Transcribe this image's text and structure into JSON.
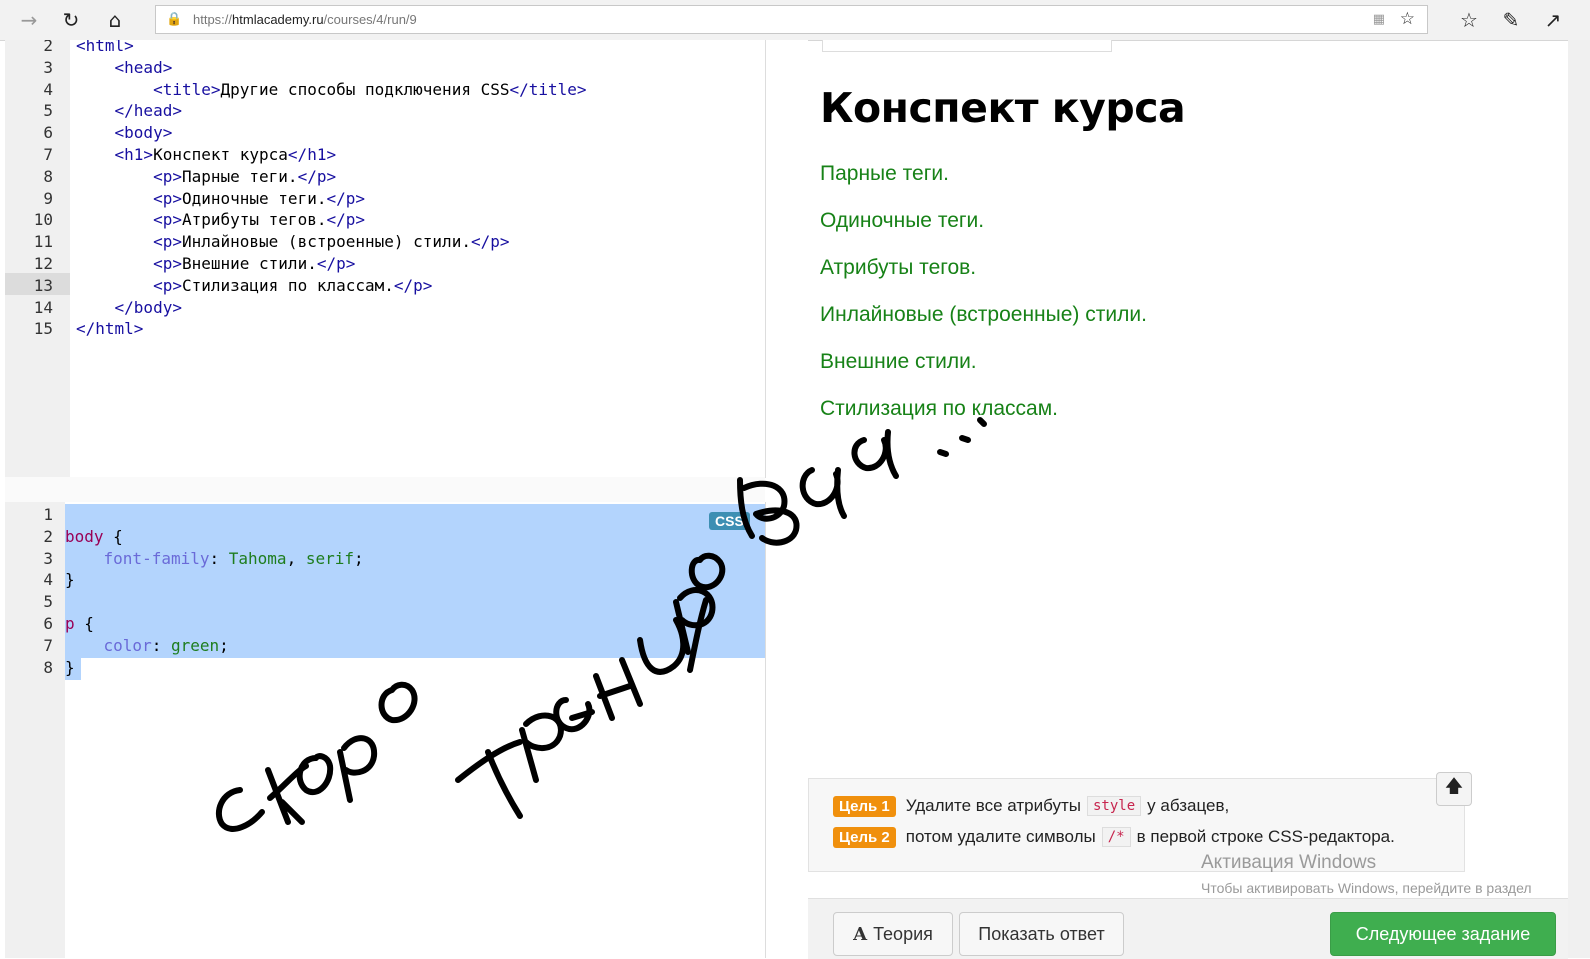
{
  "browser": {
    "url_prefix": "https://",
    "url_host": "htmlacademy.ru",
    "url_path": "/courses/4/run/9",
    "nav_icons": [
      "forward-arrow-icon",
      "refresh-icon",
      "home-icon"
    ],
    "right_icons": [
      "favorites-icon",
      "pen-icon",
      "share-icon"
    ]
  },
  "html_editor": {
    "lines": [
      {
        "num": "2",
        "html": "<span class='tag'>&lt;html&gt;</span>"
      },
      {
        "num": "3",
        "html": "    <span class='tag'>&lt;head&gt;</span>"
      },
      {
        "num": "4",
        "html": "        <span class='tag'>&lt;title&gt;</span>Другие способы подключения CSS<span class='tag'>&lt;/title&gt;</span>"
      },
      {
        "num": "5",
        "html": "    <span class='tag'>&lt;/head&gt;</span>"
      },
      {
        "num": "6",
        "html": "    <span class='tag'>&lt;body&gt;</span>"
      },
      {
        "num": "7",
        "html": "    <span class='tag'>&lt;h1&gt;</span>Конспект курса<span class='tag'>&lt;/h1&gt;</span>"
      },
      {
        "num": "8",
        "html": "        <span class='tag'>&lt;p&gt;</span>Парные теги.<span class='tag'>&lt;/p&gt;</span>"
      },
      {
        "num": "9",
        "html": "        <span class='tag'>&lt;p&gt;</span>Одиночные теги.<span class='tag'>&lt;/p&gt;</span>"
      },
      {
        "num": "10",
        "html": "        <span class='tag'>&lt;p&gt;</span>Атрибуты тегов.<span class='tag'>&lt;/p&gt;</span>"
      },
      {
        "num": "11",
        "html": "        <span class='tag'>&lt;p&gt;</span>Инлайновые (встроенные) стили.<span class='tag'>&lt;/p&gt;</span>"
      },
      {
        "num": "12",
        "html": "        <span class='tag'>&lt;p&gt;</span>Внешние стили.<span class='tag'>&lt;/p&gt;</span>"
      },
      {
        "num": "13",
        "html": "        <span class='tag'>&lt;p&gt;</span>Стилизация по классам.<span class='tag'>&lt;/p&gt;</span>"
      },
      {
        "num": "14",
        "html": "    <span class='tag'>&lt;/body&gt;</span>"
      },
      {
        "num": "15",
        "html": "<span class='tag'>&lt;/html&gt;</span>"
      }
    ]
  },
  "css_editor": {
    "badge": "CSS",
    "lines": [
      {
        "num": "1",
        "html": ""
      },
      {
        "num": "2",
        "html": "<span class='sel'>body</span> {"
      },
      {
        "num": "3",
        "html": "    <span class='prop'>font-family</span>: <span class='val'>Tahoma</span>, <span class='val'>serif</span>;"
      },
      {
        "num": "4",
        "html": "}"
      },
      {
        "num": "5",
        "html": ""
      },
      {
        "num": "6",
        "html": "<span class='sel'>p</span> {"
      },
      {
        "num": "7",
        "html": "    <span class='prop'>color</span>: <span class='val'>green</span>;"
      },
      {
        "num": "8",
        "html": "}"
      }
    ]
  },
  "preview": {
    "heading": "Конспект курса",
    "paragraphs": [
      "Парные теги.",
      "Одиночные теги.",
      "Атрибуты тегов.",
      "Инлайновые (встроенные) стили.",
      "Внешние стили.",
      "Стилизация по классам."
    ],
    "paragraph_color": "#178217"
  },
  "task": {
    "goal1_badge": "Цель 1",
    "goal1_text_a": "Удалите все атрибуты",
    "goal1_code": "style",
    "goal1_text_b": "у абзацев,",
    "goal2_badge": "Цель 2",
    "goal2_text_a": "потом удалите символы",
    "goal2_code": "/*",
    "goal2_text_b": "в первой строке CSS-редактора."
  },
  "activation": {
    "title": "Активация Windows",
    "text": "Чтобы активировать Windows, перейдите в раздел \"Параметры\"."
  },
  "buttons": {
    "theory": "Теория",
    "theory_icon": "A",
    "show_answer": "Показать ответ",
    "next_task": "Следующее задание"
  }
}
